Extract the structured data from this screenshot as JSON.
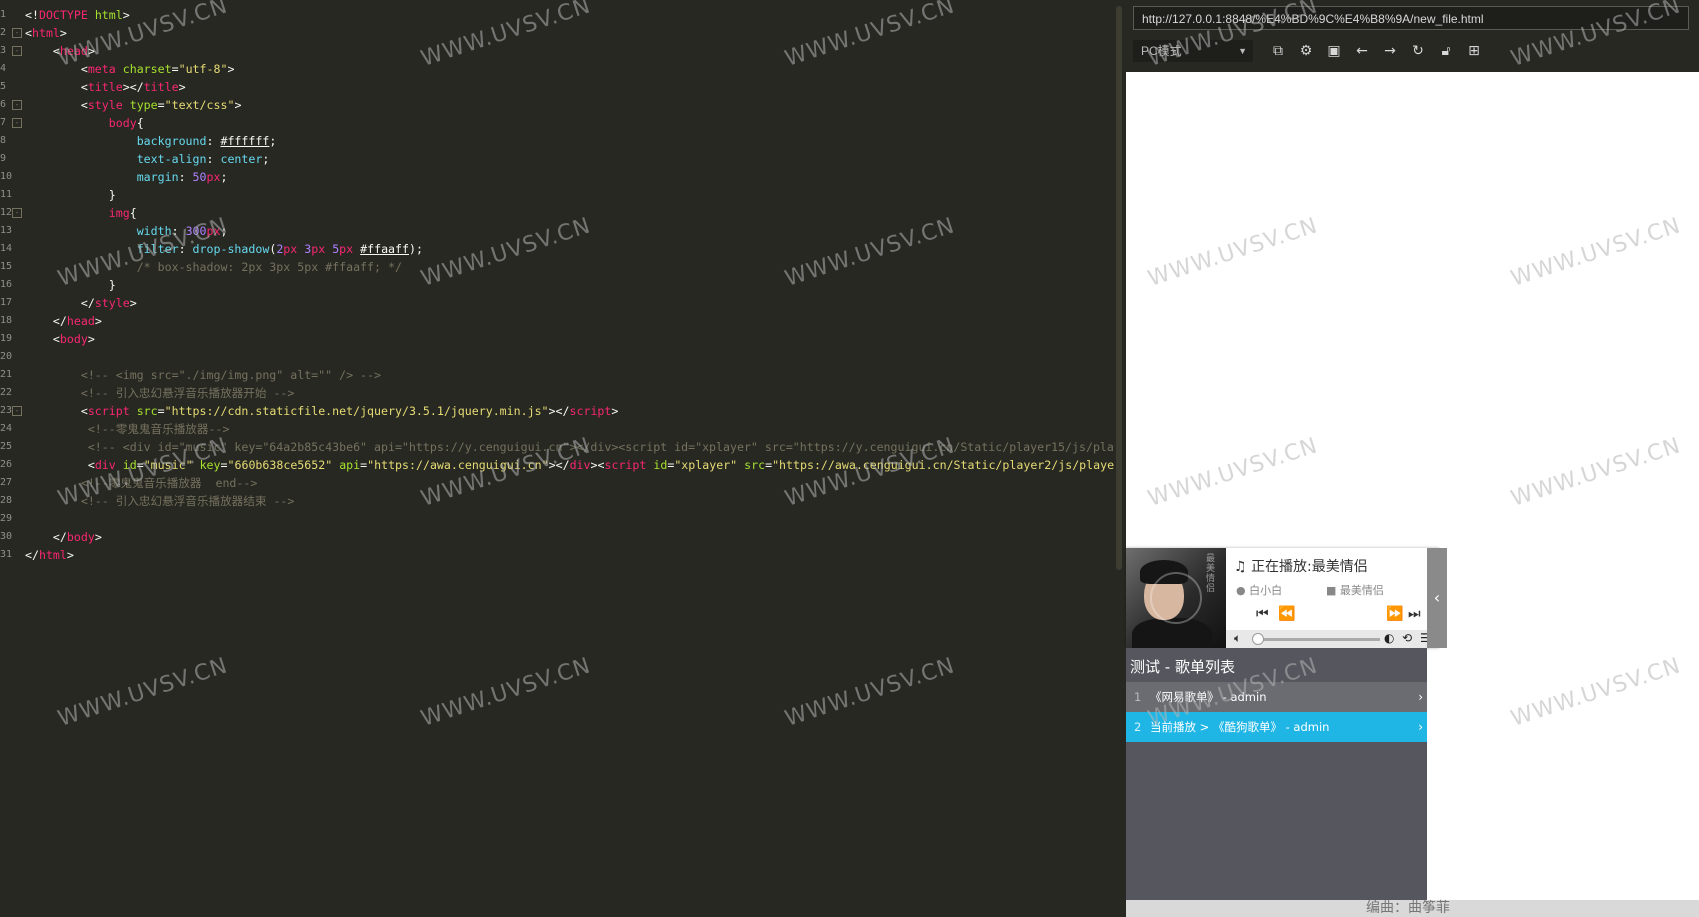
{
  "editor": {
    "lines": [
      {
        "n": "1",
        "fold": "",
        "html": "<span class='p'>&lt;!</span><span class='t'>DOCTYPE</span> <span class='a'>html</span><span class='p'>&gt;</span>"
      },
      {
        "n": "2",
        "fold": "-",
        "html": "<span class='p'>&lt;</span><span class='t'>html</span><span class='p'>&gt;</span>"
      },
      {
        "n": "3",
        "fold": "-",
        "html": "    <span class='p'>&lt;</span><span class='t'>head</span><span class='p'>&gt;</span>"
      },
      {
        "n": "4",
        "fold": "",
        "html": "        <span class='p'>&lt;</span><span class='t'>meta</span> <span class='a'>charset</span><span class='p'>=</span><span class='s'>\"utf-8\"</span><span class='p'>&gt;</span>"
      },
      {
        "n": "5",
        "fold": "",
        "html": "        <span class='p'>&lt;</span><span class='t'>title</span><span class='p'>&gt;&lt;/</span><span class='t'>title</span><span class='p'>&gt;</span>"
      },
      {
        "n": "6",
        "fold": "-",
        "html": "        <span class='p'>&lt;</span><span class='t'>style</span> <span class='a'>type</span><span class='p'>=</span><span class='s'>\"text/css\"</span><span class='p'>&gt;</span>"
      },
      {
        "n": "7",
        "fold": "-",
        "html": "            <span class='t'>body</span><span class='p'>{</span>"
      },
      {
        "n": "8",
        "fold": "",
        "html": "                <span class='k'>background</span><span class='p'>: </span><span class='p u'>#ffffff</span><span class='p'>;</span>"
      },
      {
        "n": "9",
        "fold": "",
        "html": "                <span class='k'>text-align</span><span class='p'>: </span><span class='k'>center</span><span class='p'>;</span>"
      },
      {
        "n": "10",
        "fold": "",
        "html": "                <span class='k'>margin</span><span class='p'>: </span><span class='v'>50</span><span class='t'>px</span><span class='p'>;</span>"
      },
      {
        "n": "11",
        "fold": "",
        "html": "            <span class='p'>}</span>"
      },
      {
        "n": "12",
        "fold": "-",
        "html": "            <span class='t'>img</span><span class='p'>{</span>"
      },
      {
        "n": "13",
        "fold": "",
        "html": "                <span class='k'>width</span><span class='p'>: </span><span class='v'>300</span><span class='t'>px</span><span class='p'>;</span>"
      },
      {
        "n": "14",
        "fold": "",
        "html": "                <span class='k'>filter</span><span class='p'>: </span><span class='k'>drop-shadow</span><span class='p'>(</span><span class='v'>2</span><span class='t'>px</span> <span class='v'>3</span><span class='t'>px</span> <span class='v'>5</span><span class='t'>px</span> <span class='p u'>#ffaaff</span><span class='p'>);</span>"
      },
      {
        "n": "15",
        "fold": "",
        "html": "                <span class='c'>/* box-shadow: 2px 3px 5px #ffaaff; */</span>"
      },
      {
        "n": "16",
        "fold": "",
        "html": "            <span class='p'>}</span>"
      },
      {
        "n": "17",
        "fold": "",
        "html": "        <span class='p'>&lt;/</span><span class='t'>style</span><span class='p'>&gt;</span>"
      },
      {
        "n": "18",
        "fold": "",
        "html": "    <span class='p'>&lt;/</span><span class='t'>head</span><span class='p'>&gt;</span>"
      },
      {
        "n": "19",
        "fold": "",
        "html": "    <span class='p'>&lt;</span><span class='t'>body</span><span class='p'>&gt;</span>"
      },
      {
        "n": "20",
        "fold": "",
        "html": ""
      },
      {
        "n": "21",
        "fold": "",
        "html": "        <span class='c'>&lt;!-- &lt;img src=\"./img/img.png\" alt=\"\" /&gt; --&gt;</span>"
      },
      {
        "n": "22",
        "fold": "",
        "html": "        <span class='c'>&lt;!-- 引入忠幻悬浮音乐播放器开始 --&gt;</span>"
      },
      {
        "n": "23",
        "fold": "-",
        "html": "        <span class='p'>&lt;</span><span class='t'>script</span> <span class='a'>src</span><span class='p'>=</span><span class='s'>\"https://cdn.staticfile.net/jquery/3.5.1/jquery.min.js\"</span><span class='p'>&gt;&lt;/</span><span class='t'>script</span><span class='p'>&gt;</span>"
      },
      {
        "n": "24",
        "fold": "",
        "html": "         <span class='c'>&lt;!--零鬼鬼音乐播放器--&gt;</span>"
      },
      {
        "n": "25",
        "fold": "",
        "html": "         <span class='c'>&lt;!-- &lt;div id=\"music\" key=\"64a2b85c43be6\" api=\"https://y.cenguigui.cn\"&gt;&lt;/div&gt;&lt;script id=\"xplayer\" src=\"https://y.cenguigui.cn/Static/player15/js/pla</span>"
      },
      {
        "n": "26",
        "fold": "",
        "html": "         <span class='p'>&lt;</span><span class='t'>div</span> <span class='a'>id</span><span class='p'>=</span><span class='s'>\"music\"</span> <span class='a'>key</span><span class='p'>=</span><span class='s'>\"660b638ce5652\"</span> <span class='a'>api</span><span class='p'>=</span><span class='s'>\"https://awa.cenguigui.cn\"</span><span class='p'>&gt;&lt;/</span><span class='t'>div</span><span class='p'>&gt;&lt;</span><span class='t'>script</span> <span class='a'>id</span><span class='p'>=</span><span class='s'>\"xplayer\"</span> <span class='a'>src</span><span class='p'>=</span><span class='s'>\"https://awa.cenguigui.cn/Static/player2/js/playe</span>"
      },
      {
        "n": "27",
        "fold": "",
        "html": "        <span class='c'>&lt;!--零鬼鬼音乐播放器  end--&gt;</span>"
      },
      {
        "n": "28",
        "fold": "",
        "html": "        <span class='c'>&lt;!-- 引入忠幻悬浮音乐播放器结束 --&gt;</span>"
      },
      {
        "n": "29",
        "fold": "",
        "html": ""
      },
      {
        "n": "30",
        "fold": "",
        "html": "    <span class='p'>&lt;/</span><span class='t'>body</span><span class='p'>&gt;</span>"
      },
      {
        "n": "31",
        "fold": "",
        "html": "<span class='p'>&lt;/</span><span class='t'>html</span><span class='p'>&gt;</span>"
      }
    ]
  },
  "preview": {
    "url": "http://127.0.0.1:8848/%E4%BD%9C%E4%B8%9A/new_file.html",
    "device": "PC模式",
    "toolbar_icons": [
      "open-external-icon",
      "settings-icon",
      "console-icon",
      "back-icon",
      "forward-icon",
      "refresh-icon",
      "lock-icon",
      "grid-icon"
    ],
    "footer": "编曲：曲筝菲"
  },
  "player": {
    "now_playing": "正在播放:最美情侣",
    "artist": "白小白",
    "album": "最美情侣",
    "cover_text": "最美情侣",
    "playlist_title": "测试 - 歌单列表",
    "playlist": [
      {
        "num": "1",
        "label": "《网易歌单》 - admin"
      },
      {
        "num": "2",
        "label": "当前播放 > 《酷狗歌单》 - admin"
      }
    ],
    "accent": "#1fb6e6"
  },
  "watermark": "WWW.UVSV.CN"
}
